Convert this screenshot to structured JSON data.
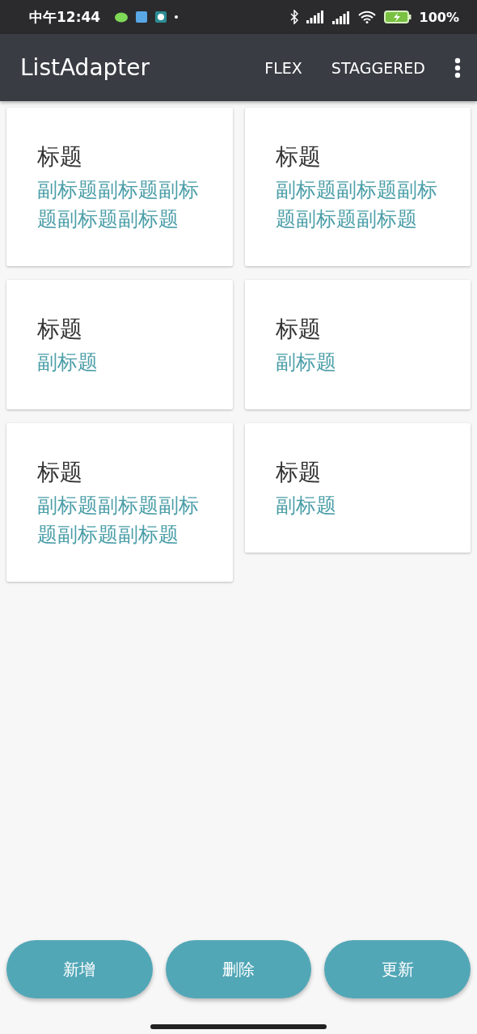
{
  "status_bar": {
    "time": "中午12:44",
    "battery": "100%"
  },
  "toolbar": {
    "title": "ListAdapter",
    "actions": [
      "FLEX",
      "STAGGERED"
    ]
  },
  "cards": [
    {
      "title": "标题",
      "subtitle": "副标题副标题副标题副标题副标题"
    },
    {
      "title": "标题",
      "subtitle": "副标题副标题副标题副标题副标题"
    },
    {
      "title": "标题",
      "subtitle": "副标题"
    },
    {
      "title": "标题",
      "subtitle": "副标题"
    },
    {
      "title": "标题",
      "subtitle": "副标题副标题副标题副标题副标题"
    },
    {
      "title": "标题",
      "subtitle": "副标题"
    }
  ],
  "buttons": [
    "新增",
    "删除",
    "更新"
  ]
}
